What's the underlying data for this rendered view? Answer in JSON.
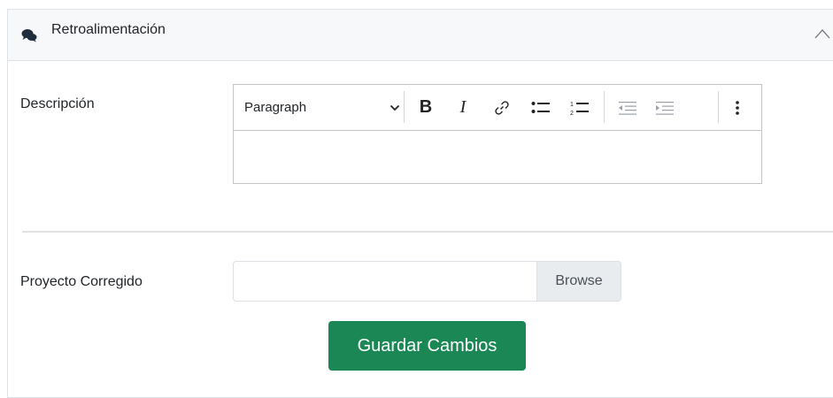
{
  "header": {
    "title": "Retroalimentación",
    "icon": "comments-icon",
    "collapse_icon": "chevron-up-icon"
  },
  "description": {
    "label": "Descripción",
    "editor": {
      "heading_select": "Paragraph",
      "content": ""
    }
  },
  "file": {
    "label": "Proyecto Corregido",
    "value": "",
    "browse_label": "Browse"
  },
  "actions": {
    "save_label": "Guardar Cambios"
  },
  "colors": {
    "primary_button": "#1a8754",
    "header_bg": "#f7f8fa"
  }
}
